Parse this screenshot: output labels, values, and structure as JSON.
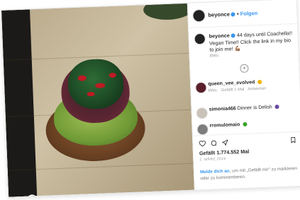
{
  "post": {
    "username": "beyonce",
    "follow_label": "Folgen",
    "caption_user": "beyonce",
    "caption_text": "44 days until Coachella!! Vegan Time!! Click the link in my bio to join me! 💪🏽",
    "caption_meta": "8Wo.",
    "likes_text": "Gefällt 1.774.552 Mal",
    "date_text": "2. MÄRZ 2019"
  },
  "comments": [
    {
      "user": "queen_vee_evolved",
      "text": "",
      "meta": "8Wo.",
      "like_label": "Gefällt 1 Mal",
      "reply_label": "Antworten",
      "emoji_color": "#f0b400"
    },
    {
      "user": "simonia466",
      "text": "Dinner is Delish",
      "meta": "",
      "like_label": "",
      "reply_label": "",
      "emoji_color": "#6a4aa0"
    },
    {
      "user": "rromulomaio",
      "text": "",
      "meta": "",
      "like_label": "",
      "reply_label": "",
      "emoji_color": "#3aa02b"
    }
  ],
  "login_prompt": {
    "link_text": "Melde dich an",
    "rest_text": ", um mit „Gefällt mir\" zu markieren oder zu kommentieren."
  },
  "icons": {
    "heart": "heart-icon",
    "comment": "comment-icon",
    "share": "share-icon",
    "bookmark": "bookmark-icon",
    "load_more": "plus-circle-icon",
    "verified": "verified-badge-icon"
  },
  "colors": {
    "link": "#3897f0",
    "text": "#262626",
    "muted": "#999999"
  }
}
